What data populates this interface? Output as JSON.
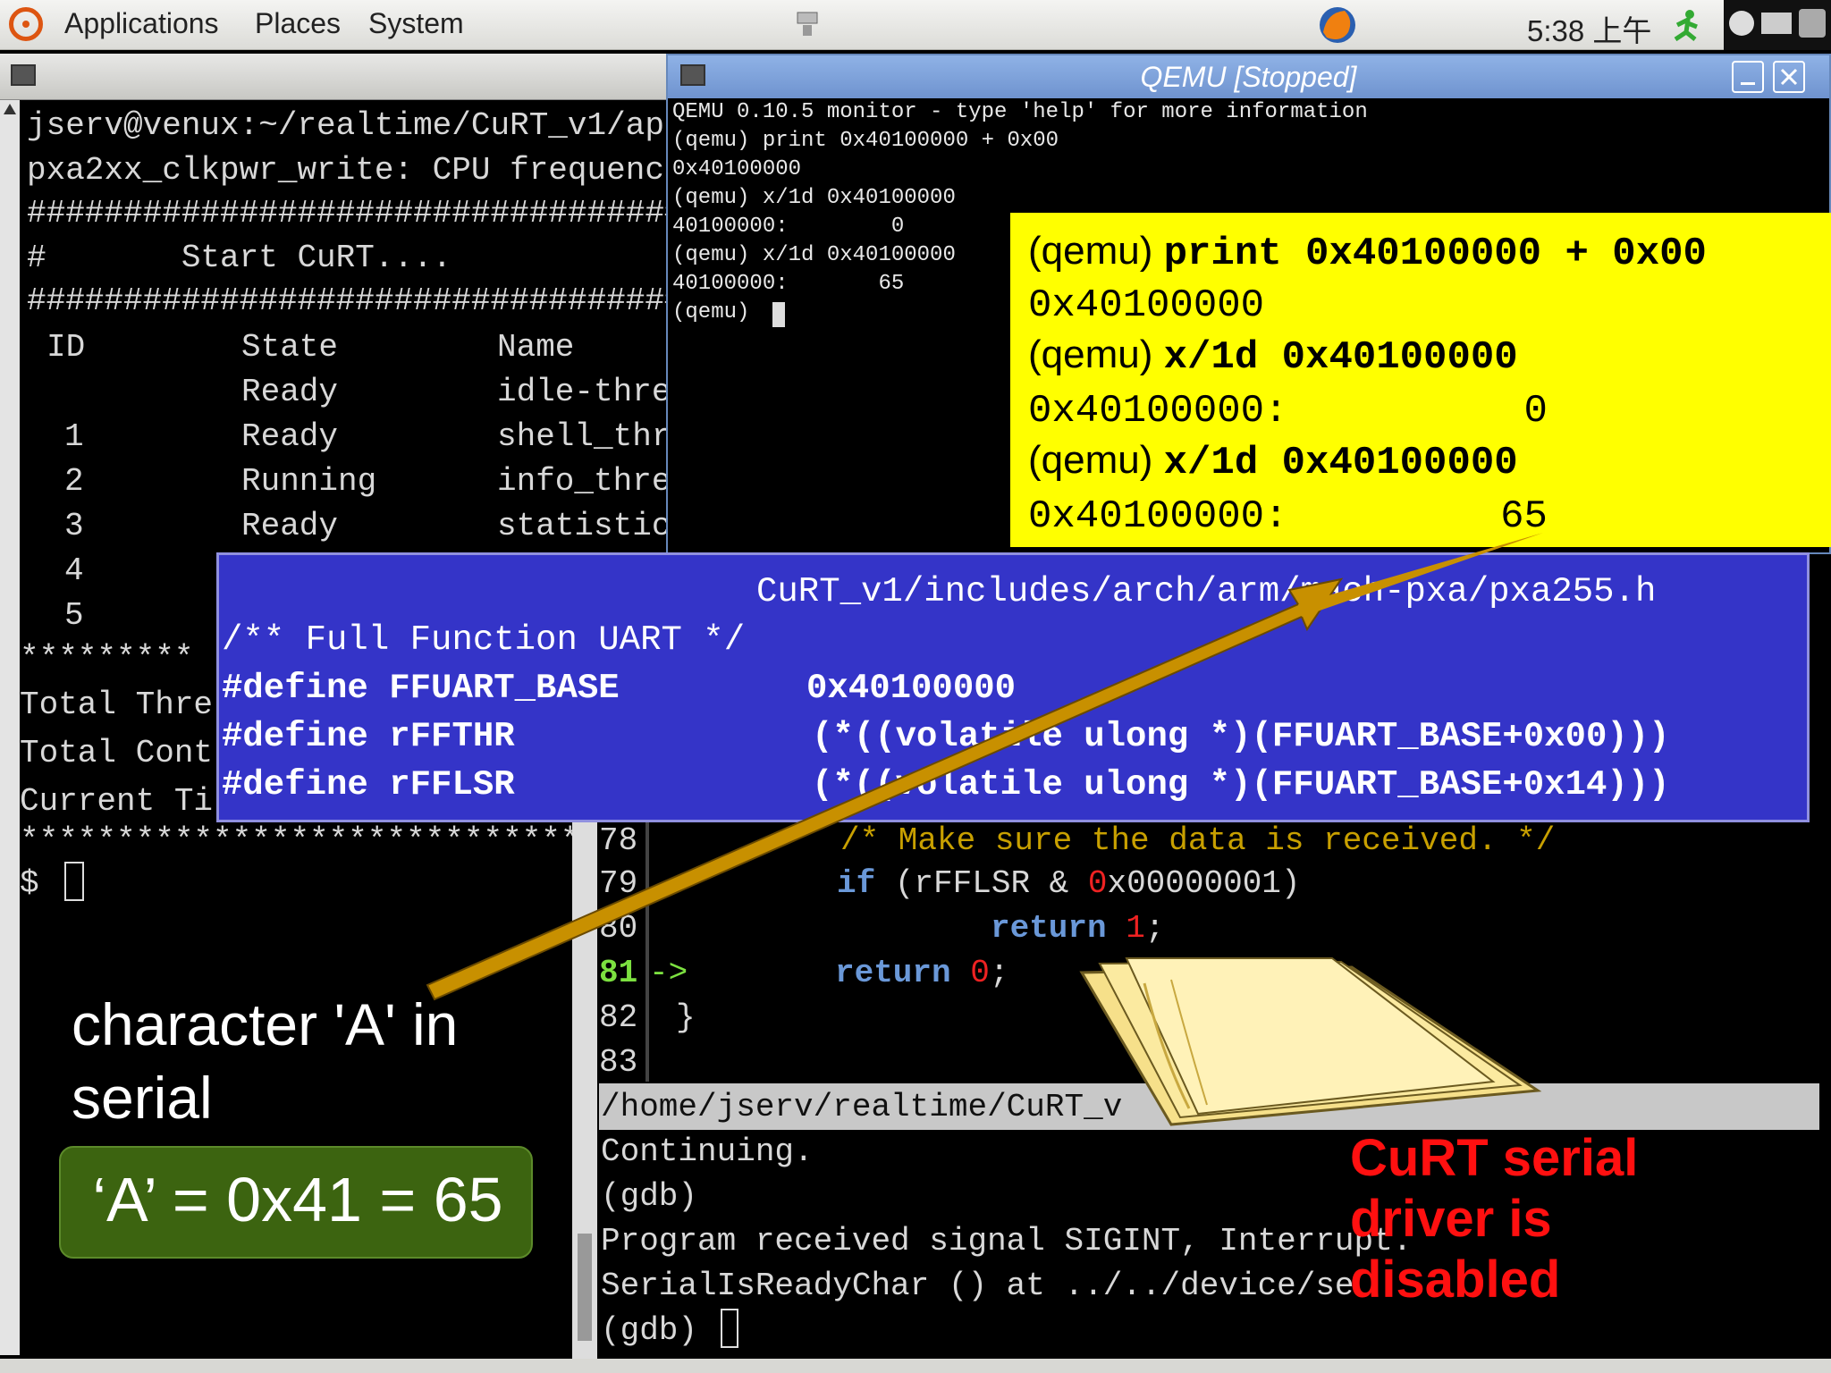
{
  "top_panel": {
    "menus": [
      "Applications",
      "Places",
      "System"
    ],
    "clock": "5:38 上午",
    "icons": [
      "ubuntu-logo-icon",
      "network-icon",
      "firefox-icon",
      "runner-icon",
      "clock-applet-icon",
      "keyboard-icon",
      "printer-icon"
    ]
  },
  "left_terminal": {
    "lines": [
      "jserv@venux:~/realtime/CuRT_v1/ap",
      "pxa2xx_clkpwr_write: CPU frequenc",
      "##################################",
      "#       Start CuRT....",
      "##################################"
    ],
    "table_header": {
      "id": "ID",
      "state": "State",
      "name": "Name"
    },
    "rows": [
      {
        "id": "",
        "state": "Ready",
        "name": "idle-thre"
      },
      {
        "id": "1",
        "state": "Ready",
        "name": "shell_thr"
      },
      {
        "id": "2",
        "state": "Running",
        "name": "info_thre"
      },
      {
        "id": "3",
        "state": "Ready",
        "name": "statistic"
      },
      {
        "id": "4",
        "state": "",
        "name": ""
      },
      {
        "id": "5",
        "state": "",
        "name": ""
      }
    ],
    "stars": "*********",
    "totals": [
      "Total Thre",
      "Total Cont",
      "Current Ti"
    ],
    "stars2": "******************************",
    "prompt": "$"
  },
  "qemu": {
    "title": "QEMU [Stopped]",
    "lines": [
      "QEMU 0.10.5 monitor - type 'help' for more information",
      "(qemu) print 0x40100000 + 0x00",
      "0x40100000",
      "(qemu) x/1d 0x40100000",
      "40100000:        0",
      "(qemu) x/1d 0x40100000",
      "40100000:       65",
      "(qemu)"
    ]
  },
  "yellow_callout": {
    "l1_prompt": "(qemu)",
    "l1_cmd": "print 0x40100000 + 0x00",
    "l2": "0x40100000",
    "l3_prompt": "(qemu)",
    "l3_cmd": "x/1d 0x40100000",
    "l4": "0x40100000:          0",
    "l5_prompt": "(qemu)",
    "l5_cmd": "x/1d 0x40100000",
    "l6": "0x40100000:         65"
  },
  "blue_callout": {
    "path": "CuRT_v1/includes/arch/arm/mach-pxa/pxa255.h",
    "comment": "/** Full Function UART */",
    "defines": [
      {
        "kw": "#define FFUART_BASE",
        "val": "0x40100000"
      },
      {
        "kw": "#define rFFTHR",
        "val": "(*((volatile ulong *)(FFUART_BASE+0x00)))"
      },
      {
        "kw": "#define rFFLSR",
        "val": "(*((volatile ulong *)(FFUART_BASE+0x14)))"
      }
    ]
  },
  "gdb": {
    "source": [
      {
        "num": "78",
        "code_comment": "/* Make sure the data is received. */"
      },
      {
        "num": "79",
        "kw": "if",
        "rest1": " (rFFLSR & ",
        "red": "0",
        "rest2": "x00000001)"
      },
      {
        "num": "80",
        "kw": "return",
        "red": "1",
        "rest": ";"
      },
      {
        "num": "81",
        "arrow": "->",
        "kw": "return",
        "red": "0",
        "rest": ";"
      },
      {
        "num": "82",
        "brace": "}"
      },
      {
        "num": "83"
      }
    ],
    "status": "/home/jserv/realtime/CuRT_v",
    "output": [
      "Continuing.",
      "(gdb)",
      "Program received signal SIGINT, Interrupt.",
      "SerialIsReadyChar () at ../../device/se",
      "(gdb)"
    ]
  },
  "annotations": {
    "char_label_1": "character 'A' in",
    "char_label_2": "serial",
    "green_box": "‘A’ = 0x41 = 65",
    "red_1": "CuRT serial",
    "red_2": "driver is",
    "red_3": "disabled"
  },
  "colors": {
    "yellow": "#ffff00",
    "blue": "#3434c8",
    "green": "#3c6410",
    "red": "#ff1010",
    "arrow": "#c89000"
  }
}
